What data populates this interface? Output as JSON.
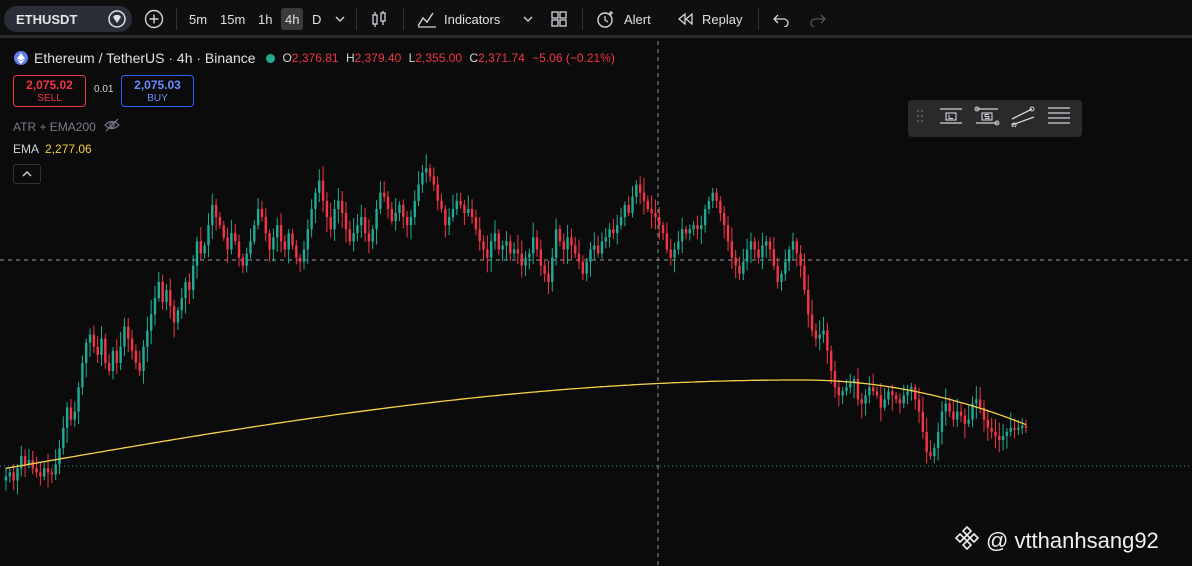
{
  "toolbar": {
    "symbol": "ETHUSDT",
    "timeframes": [
      "5m",
      "15m",
      "1h",
      "4h",
      "D"
    ],
    "active_timeframe": "4h",
    "indicators_label": "Indicators",
    "alert_label": "Alert",
    "replay_label": "Replay"
  },
  "legend": {
    "title": "Ethereum / TetherUS · 4h · Binance",
    "open_key": "O",
    "open": "2,376.81",
    "high_key": "H",
    "high": "2,379.40",
    "low_key": "L",
    "low": "2,355.00",
    "close_key": "C",
    "close": "2,371.74",
    "change": "−5.06 (−0.21%)"
  },
  "trade": {
    "sell_price": "2,075.02",
    "sell_label": "SELL",
    "quantity": "0.01",
    "buy_price": "2,075.03",
    "buy_label": "BUY"
  },
  "indicators": {
    "label": "ATR + EMA200",
    "ema_key": "EMA",
    "ema_value": "2,277.06"
  },
  "colors": {
    "up": "#22ab94",
    "down": "#f23645",
    "ema": "#f5d24b"
  },
  "watermark": "@ vtthanhsang92",
  "chart_data": {
    "type": "candlestick",
    "close": [
      2040,
      2050,
      2030,
      2060,
      2090,
      2070,
      2080,
      2060,
      2050,
      2040,
      2060,
      2050,
      2045,
      2070,
      2110,
      2160,
      2210,
      2180,
      2200,
      2260,
      2320,
      2370,
      2390,
      2360,
      2340,
      2380,
      2320,
      2300,
      2350,
      2320,
      2360,
      2410,
      2380,
      2350,
      2320,
      2300,
      2360,
      2400,
      2440,
      2480,
      2520,
      2470,
      2500,
      2460,
      2420,
      2450,
      2480,
      2520,
      2500,
      2560,
      2620,
      2590,
      2610,
      2660,
      2710,
      2680,
      2660,
      2630,
      2600,
      2640,
      2620,
      2580,
      2560,
      2590,
      2620,
      2660,
      2700,
      2680,
      2640,
      2600,
      2630,
      2660,
      2620,
      2600,
      2640,
      2610,
      2580,
      2570,
      2600,
      2650,
      2700,
      2740,
      2770,
      2720,
      2680,
      2650,
      2700,
      2720,
      2690,
      2650,
      2620,
      2640,
      2660,
      2680,
      2640,
      2620,
      2650,
      2700,
      2740,
      2730,
      2700,
      2670,
      2690,
      2710,
      2680,
      2660,
      2680,
      2720,
      2760,
      2790,
      2800,
      2780,
      2760,
      2720,
      2700,
      2660,
      2680,
      2700,
      2720,
      2710,
      2690,
      2700,
      2680,
      2650,
      2620,
      2600,
      2580,
      2620,
      2640,
      2600,
      2610,
      2620,
      2590,
      2600,
      2590,
      2560,
      2580,
      2590,
      2630,
      2600,
      2560,
      2540,
      2520,
      2580,
      2650,
      2620,
      2600,
      2630,
      2610,
      2590,
      2570,
      2540,
      2570,
      2600,
      2610,
      2590,
      2620,
      2630,
      2650,
      2640,
      2660,
      2680,
      2710,
      2690,
      2730,
      2760,
      2740,
      2720,
      2700,
      2690,
      2680,
      2660,
      2640,
      2600,
      2580,
      2600,
      2620,
      2650,
      2640,
      2650,
      2660,
      2650,
      2660,
      2700,
      2720,
      2740,
      2720,
      2690,
      2660,
      2620,
      2580,
      2560,
      2540,
      2570,
      2600,
      2620,
      2600,
      2580,
      2610,
      2620,
      2600,
      2560,
      2520,
      2540,
      2570,
      2600,
      2620,
      2590,
      2560,
      2500,
      2440,
      2400,
      2380,
      2390,
      2400,
      2350,
      2300,
      2260,
      2240,
      2250,
      2260,
      2270,
      2280,
      2230,
      2220,
      2240,
      2260,
      2250,
      2240,
      2210,
      2230,
      2250,
      2240,
      2230,
      2220,
      2240,
      2250,
      2260,
      2230,
      2200,
      2150,
      2100,
      2090,
      2110,
      2150,
      2200,
      2220,
      2200,
      2180,
      2200,
      2190,
      2170,
      2180,
      2220,
      2230,
      2210,
      2180,
      2160,
      2150,
      2140,
      2130,
      2140,
      2150,
      2160,
      2155,
      2160,
      2165,
      2160
    ],
    "ema200_range": [
      2060,
      2278
    ],
    "note_axis": "price USDT"
  }
}
